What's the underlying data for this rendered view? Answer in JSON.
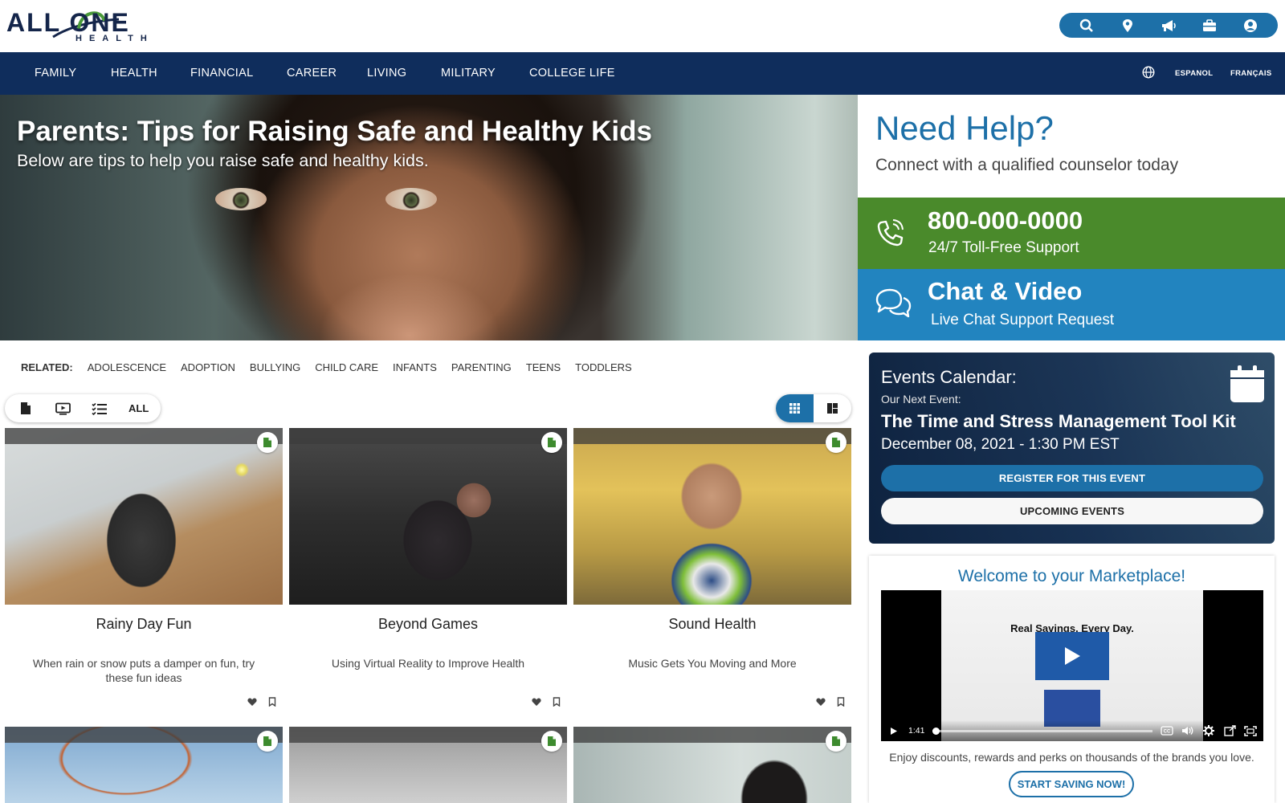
{
  "brand": {
    "logo_main": "ALL ONE",
    "logo_sub": "HEALTH",
    "accent": "#1d70a8",
    "nav_bg": "#0f2d5c",
    "green": "#4a8a2b",
    "blue": "#2284bf"
  },
  "utility_icons": [
    "search-icon",
    "location-icon",
    "megaphone-icon",
    "briefcase-icon",
    "user-icon"
  ],
  "nav": {
    "items": [
      "FAMILY",
      "HEALTH",
      "FINANCIAL",
      "CAREER",
      "LIVING",
      "MILITARY",
      "COLLEGE LIFE"
    ],
    "languages": [
      "ESPANOL",
      "FRANÇAIS"
    ]
  },
  "hero": {
    "title": "Parents: Tips for Raising Safe and Healthy Kids",
    "subtitle": "Below are tips to help you raise safe and healthy kids."
  },
  "help": {
    "title": "Need Help?",
    "subtitle": "Connect with a qualified counselor today",
    "phone": {
      "title": "800-000-0000",
      "sub": "24/7 Toll-Free Support"
    },
    "chat": {
      "title": "Chat & Video",
      "sub": "Live Chat Support Request"
    }
  },
  "related": {
    "label": "RELATED:",
    "items": [
      "ADOLESCENCE",
      "ADOPTION",
      "BULLYING",
      "CHILD CARE",
      "INFANTS",
      "PARENTING",
      "TEENS",
      "TODDLERS"
    ]
  },
  "filters": {
    "all_label": "ALL",
    "icons": [
      "document-icon",
      "video-icon",
      "checklist-icon"
    ]
  },
  "cards": [
    {
      "title": "Rainy Day Fun",
      "desc": "When rain or snow puts a damper on fun, try these fun ideas"
    },
    {
      "title": "Beyond Games",
      "desc": "Using Virtual Reality to Improve Health"
    },
    {
      "title": "Sound Health",
      "desc": "Music Gets You Moving and More"
    }
  ],
  "events": {
    "title": "Events Calendar:",
    "next_label": "Our Next Event:",
    "name": "The Time and Stress Management Tool Kit",
    "date": "December 08, 2021 - 1:30 PM EST",
    "register": "REGISTER FOR THIS EVENT",
    "upcoming": "UPCOMING EVENTS"
  },
  "market": {
    "title": "Welcome to your Marketplace!",
    "video_caption": "Real Savings. Every Day.",
    "video_time": "1:41",
    "text": "Enjoy discounts, rewards and perks on thousands of the brands you love.",
    "button": "START SAVING NOW!"
  }
}
